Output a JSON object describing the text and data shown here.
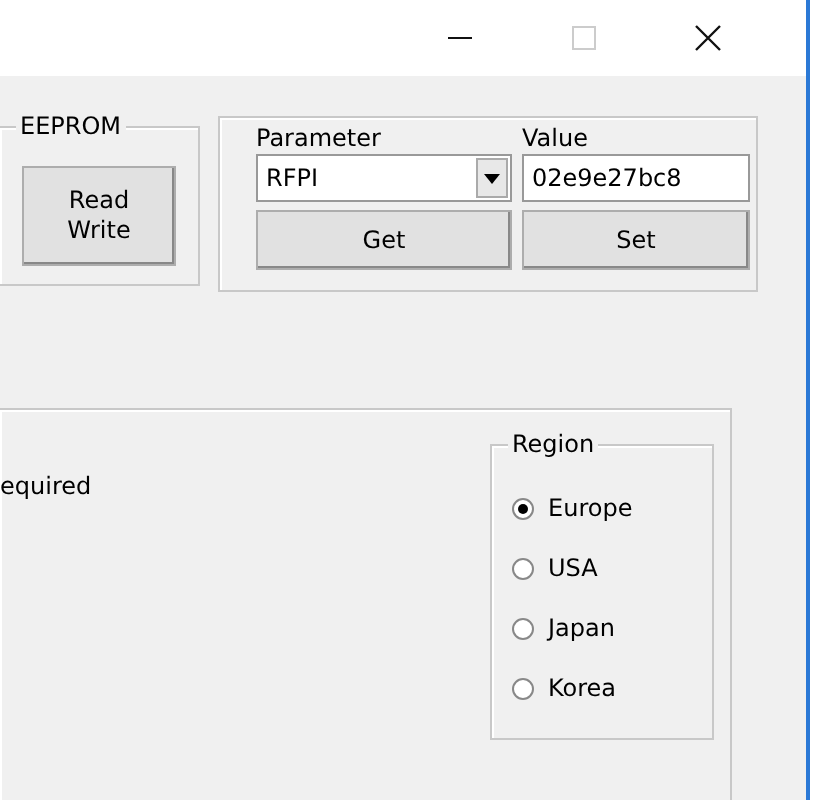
{
  "eeprom": {
    "title": "EEPROM",
    "button": [
      "Read",
      "Write"
    ]
  },
  "parameter": {
    "label": "Parameter",
    "value_label": "Value",
    "selection": "RFPI",
    "value": "02e9e27bc8",
    "buttons": [
      "Get",
      "Set"
    ]
  },
  "settings": {
    "note": "equired",
    "region": {
      "title": "Region",
      "options": [
        {
          "label": "Europe",
          "selected": true
        },
        {
          "label": "USA",
          "selected": false
        },
        {
          "label": "Japan",
          "selected": false
        },
        {
          "label": "Korea",
          "selected": false
        }
      ]
    }
  }
}
